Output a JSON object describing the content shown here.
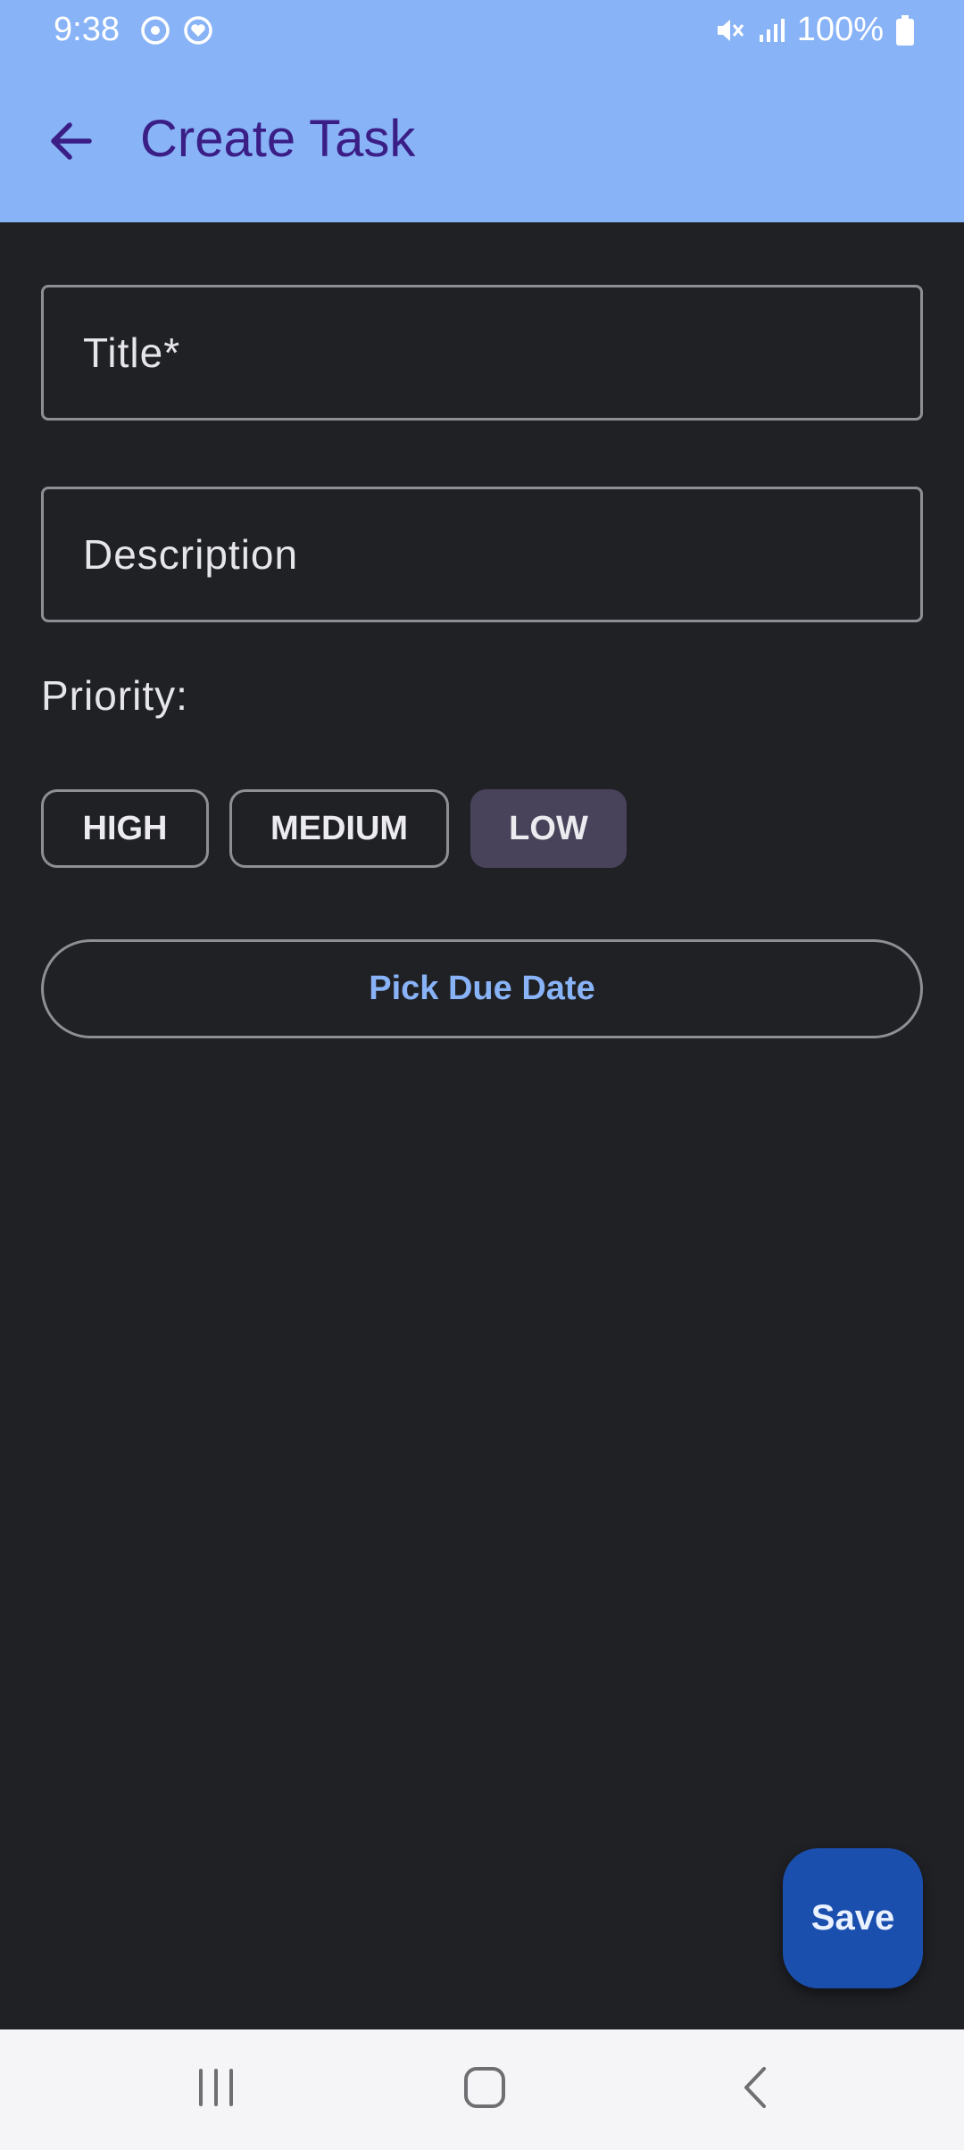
{
  "status_bar": {
    "time": "9:38",
    "battery": "100%",
    "icons": [
      "sync-icon",
      "heart-icon",
      "mute-icon",
      "signal-icon",
      "battery-icon"
    ]
  },
  "app_bar": {
    "title": "Create Task",
    "back_icon": "arrow-back-icon"
  },
  "form": {
    "title_placeholder": "Title*",
    "title_value": "",
    "description_placeholder": "Description",
    "description_value": "",
    "priority_label": "Priority:",
    "priority_options": [
      {
        "label": "HIGH",
        "selected": false
      },
      {
        "label": "MEDIUM",
        "selected": false
      },
      {
        "label": "LOW",
        "selected": true
      }
    ],
    "pick_due_date_label": "Pick Due Date"
  },
  "fab": {
    "label": "Save"
  },
  "colors": {
    "header": "#89b3f7",
    "background": "#202125",
    "title_text": "#3a1e85",
    "selected_chip": "#48435a",
    "fab": "#1a4fae",
    "accent_text": "#89b3f7"
  },
  "nav_bar": {
    "icons": [
      "recents-icon",
      "home-icon",
      "back-icon"
    ]
  }
}
